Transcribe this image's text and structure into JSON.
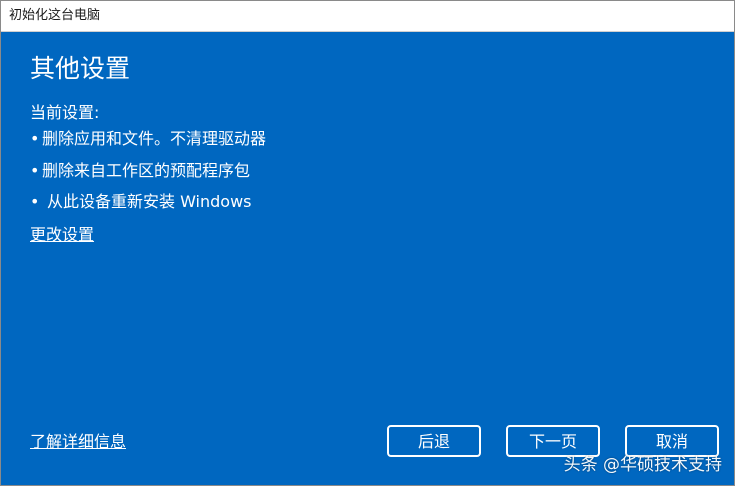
{
  "window": {
    "title": "初始化这台电脑"
  },
  "main": {
    "heading": "其他设置",
    "current_settings_label": "当前设置:",
    "bullet_symbol": "•",
    "settings": [
      "删除应用和文件。不清理驱动器",
      "删除来自工作区的预配程序包",
      "从此设备重新安装 Windows"
    ],
    "change_settings_link": "更改设置"
  },
  "footer": {
    "learn_more_link": "了解详细信息",
    "back_label": "后退",
    "next_label": "下一页",
    "cancel_label": "取消"
  },
  "watermark": {
    "text": "头条 @华硕技术支持"
  },
  "colors": {
    "background": "#0067c0",
    "titlebar": "#ffffff",
    "text": "#ffffff"
  }
}
